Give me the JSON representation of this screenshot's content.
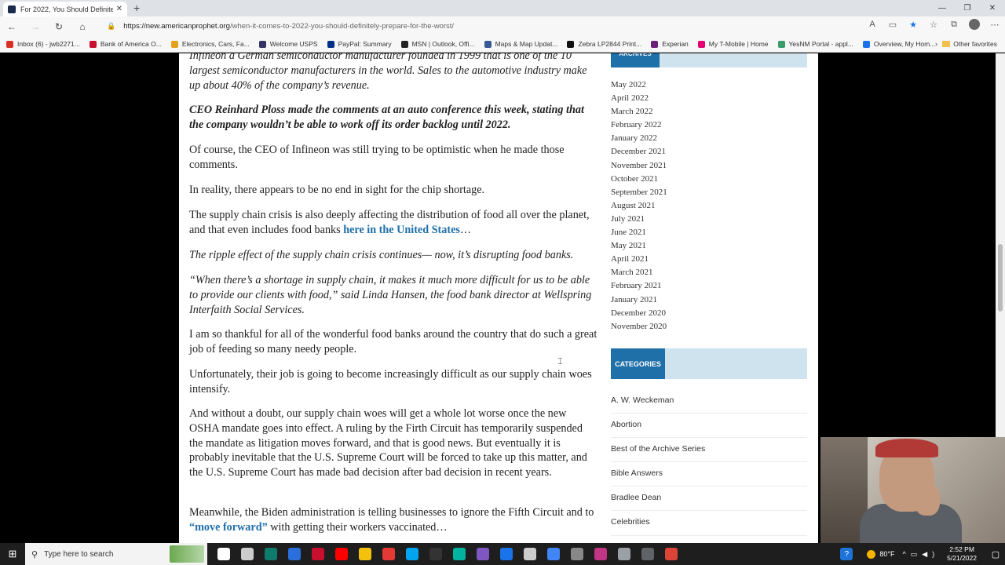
{
  "browser": {
    "tab_title": "For 2022, You Should Definitely P",
    "url_host": "https://new.americanprophet.org",
    "url_path": "/when-it-comes-to-2022-you-should-definitely-prepare-for-the-worst/",
    "bookmarks": [
      {
        "label": "Inbox (6) - jwb2271...",
        "color": "#d93025"
      },
      {
        "label": "Bank of America  O...",
        "color": "#c8102e"
      },
      {
        "label": "Electronics, Cars, Fa...",
        "color": "#e4a11b"
      },
      {
        "label": "Welcome  USPS",
        "color": "#333366"
      },
      {
        "label": "PayPal: Summary",
        "color": "#003087"
      },
      {
        "label": "MSN | Outlook, Offi...",
        "color": "#222222"
      },
      {
        "label": "Maps & Map Updat...",
        "color": "#3b5998"
      },
      {
        "label": "Zebra LP2844 Print...",
        "color": "#111111"
      },
      {
        "label": "Experian",
        "color": "#6d2077"
      },
      {
        "label": "My T-Mobile | Home",
        "color": "#e20074"
      },
      {
        "label": "YesNM Portal - appl...",
        "color": "#3c9b6b"
      },
      {
        "label": "Overview, My Hom...",
        "color": "#1a73e8"
      }
    ],
    "other_favorites": "Other favorites"
  },
  "article": {
    "p1": "Infineon a German semiconductor manufacturer founded in 1999 that is one of the 10 largest semiconductor manufacturers in the world. Sales to the automotive industry make up about 40% of the company’s revenue.",
    "p2": "CEO Reinhard Ploss made the comments at an auto conference this week, stating that the company wouldn’t be able to work off its order backlog until 2022.",
    "p3": "Of course, the CEO of Infineon was still trying to be optimistic when he made those comments.",
    "p4": "In reality, there appears to be no end in sight for the chip shortage.",
    "p5_pre": "The supply chain crisis is also deeply affecting the distribution of food all over the planet, and that even includes food banks ",
    "p5_link": "here in the United States",
    "p5_post": "…",
    "p6": "The ripple effect of the supply chain crisis continues— now, it’s disrupting food banks.",
    "p7": "“When there’s a shortage in supply chain, it makes it much more difficult for us to be able to provide our clients with food,” said Linda Hansen, the food bank director at Wellspring Interfaith Social Services.",
    "p8": "I am so thankful for all of the wonderful food banks around the country that do such a great job of feeding so many needy people.",
    "p9": "Unfortunately, their job is going to become increasingly difficult as our supply chain woes intensify.",
    "p10": "And without a doubt, our supply chain woes will get a whole lot worse once the new OSHA mandate goes into effect.  A ruling by the Firth Circuit has temporarily suspended the mandate as litigation moves forward, and that is good news.  But eventually it is probably inevitable that the U.S. Supreme Court will be forced to take up this matter, and the U.S. Supreme Court has made bad decision after bad decision in recent years.",
    "p11_pre": "Meanwhile, the Biden administration is telling businesses to ignore the Fifth Circuit and to ",
    "p11_link": "“move forward”",
    "p11_post": " with getting their workers vaccinated…"
  },
  "sidebar": {
    "archives_label": "ARCHIVES",
    "archives": [
      "May 2022",
      "April 2022",
      "March 2022",
      "February 2022",
      "January 2022",
      "December 2021",
      "November 2021",
      "October 2021",
      "September 2021",
      "August 2021",
      "July 2021",
      "June 2021",
      "May 2021",
      "April 2021",
      "March 2021",
      "February 2021",
      "January 2021",
      "December 2020",
      "November 2020"
    ],
    "categories_label": "CATEGORIES",
    "categories": [
      "A. W. Weckeman",
      "Abortion",
      "Best of the Archive Series",
      "Bible Answers",
      "Bradlee Dean",
      "Celebrities"
    ]
  },
  "taskbar": {
    "search_placeholder": "Type here to search",
    "temperature": "80°F",
    "time": "2:52 PM",
    "date": "5/21/2022",
    "icon_colors": [
      "#ffffff",
      "#cccccc",
      "#0f7b6c",
      "#2a6fdb",
      "#c8102e",
      "#ff0000",
      "#f4c20d",
      "#e53935",
      "#00a4ef",
      "#333333",
      "#00b4a0",
      "#7e57c2",
      "#1a73e8",
      "#cccccc",
      "#4285f4",
      "#888888",
      "#c13584",
      "#9aa0a6",
      "#5f6368",
      "#db4437"
    ]
  }
}
